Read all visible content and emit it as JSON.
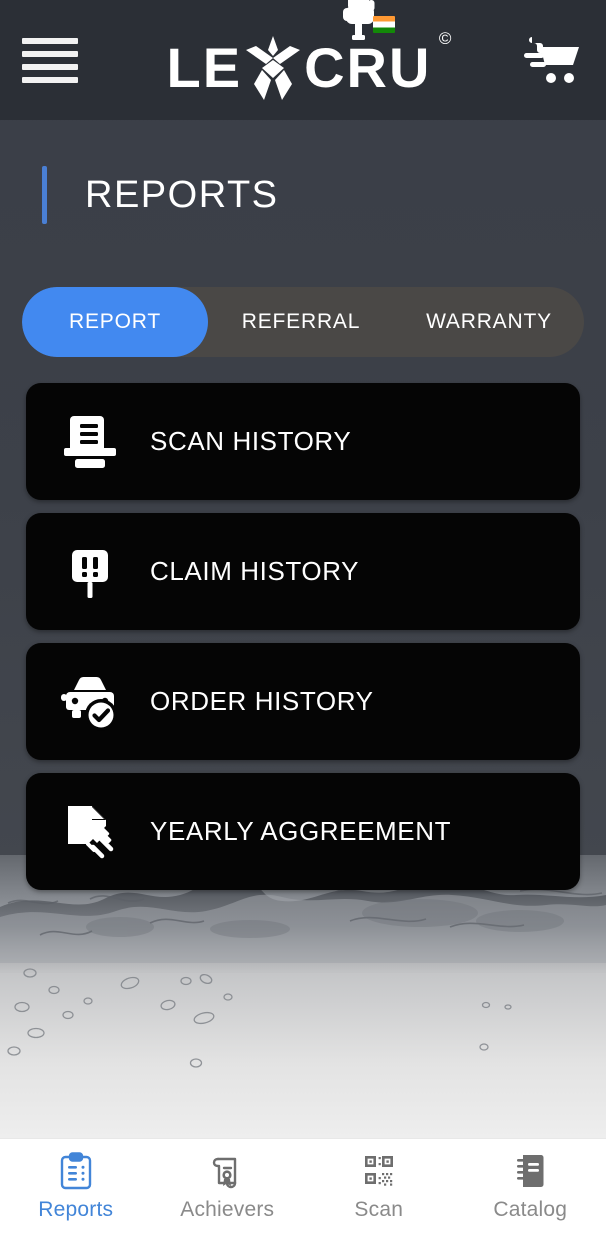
{
  "header": {
    "menu_icon": "hamburger-menu-icon",
    "logo": {
      "text_left": "LE",
      "text_right": "CRU",
      "copyright": "©",
      "fist_icon": "raised-fist-icon",
      "flag_icon": "india-flag-icon"
    },
    "cart_icon": "shopping-cart-icon"
  },
  "page": {
    "title": "REPORTS"
  },
  "tabs": [
    {
      "label": "REPORT",
      "active": true
    },
    {
      "label": "REFERRAL",
      "active": false
    },
    {
      "label": "WARRANTY",
      "active": false
    }
  ],
  "menu_items": [
    {
      "label": "SCAN HISTORY",
      "icon": "scan-document-icon"
    },
    {
      "label": "CLAIM HISTORY",
      "icon": "warning-sign-icon"
    },
    {
      "label": "ORDER HISTORY",
      "icon": "car-check-icon"
    },
    {
      "label": "YEARLY AGGREEMENT",
      "icon": "document-signature-icon"
    }
  ],
  "bottom_nav": [
    {
      "label": "Reports",
      "icon": "clipboard-icon",
      "active": true
    },
    {
      "label": "Achievers",
      "icon": "certificate-icon",
      "active": false
    },
    {
      "label": "Scan",
      "icon": "qr-code-icon",
      "active": false
    },
    {
      "label": "Catalog",
      "icon": "notebook-icon",
      "active": false
    }
  ],
  "colors": {
    "accent_blue": "#4289f0",
    "nav_active_blue": "#4285d8",
    "card_black": "#050505",
    "header_dark": "#2b2f36",
    "tab_track": "#4a4846"
  }
}
